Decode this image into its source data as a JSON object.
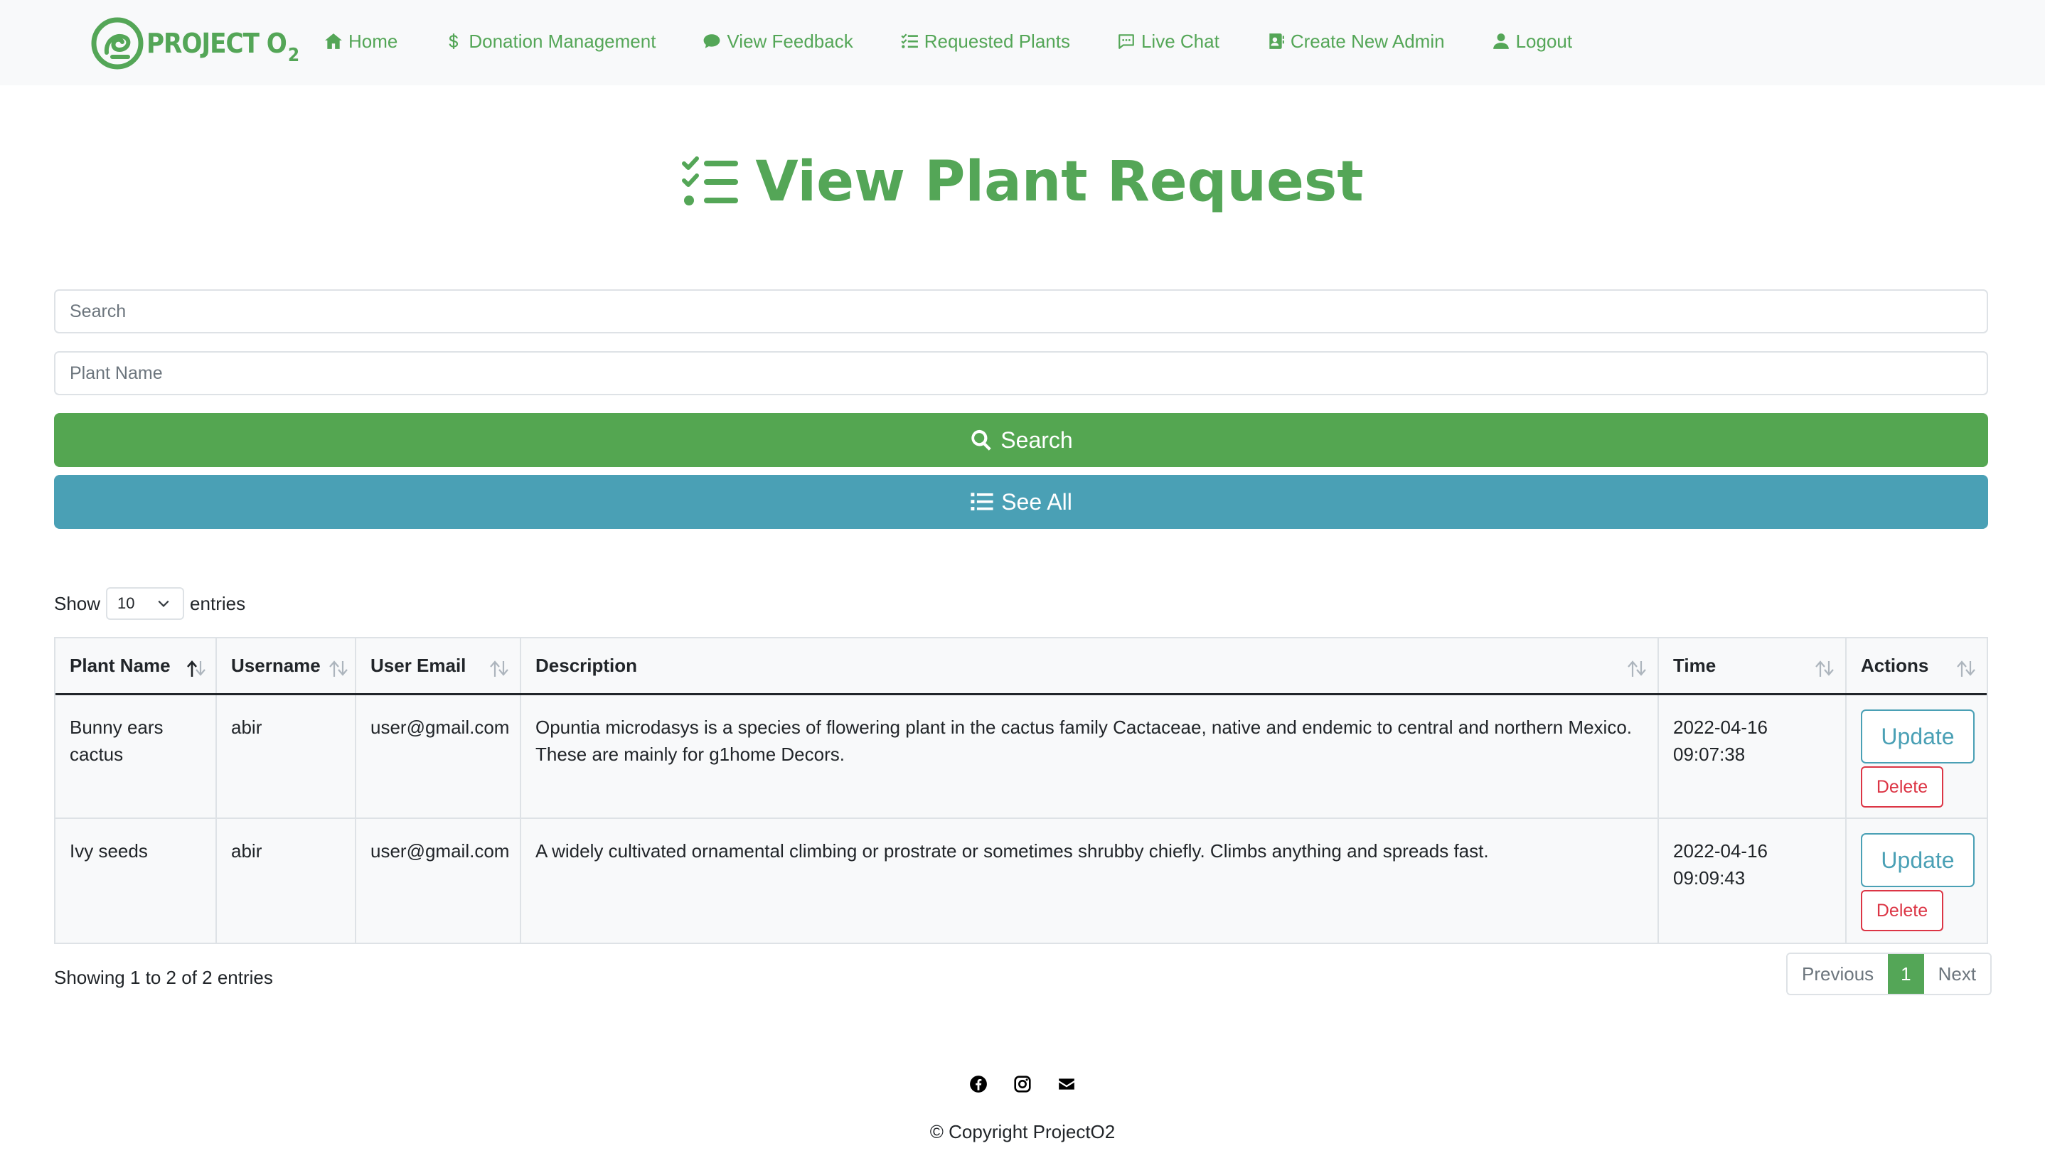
{
  "brand": {
    "name": "PROJECT O",
    "subscript": "2"
  },
  "nav": [
    {
      "label": "Home",
      "icon": "house-icon"
    },
    {
      "label": "Donation Management",
      "icon": "dollar-icon"
    },
    {
      "label": "View Feedback",
      "icon": "comment-icon"
    },
    {
      "label": "Requested Plants",
      "icon": "list-check-icon"
    },
    {
      "label": "Live Chat",
      "icon": "chat-icon"
    },
    {
      "label": "Create New Admin",
      "icon": "address-book-icon"
    },
    {
      "label": "Logout",
      "icon": "user-icon"
    }
  ],
  "page": {
    "title": "View Plant Request"
  },
  "form": {
    "search_placeholder": "Search",
    "plant_name_placeholder": "Plant Name",
    "search_button": "Search",
    "see_all_button": "See All"
  },
  "table_controls": {
    "show": "Show",
    "length_value": "10",
    "entries": "entries"
  },
  "table": {
    "columns": [
      "Plant Name",
      "Username",
      "User Email",
      "Description",
      "Time",
      "Actions"
    ],
    "rows": [
      {
        "plant_name": "Bunny ears cactus",
        "username": "abir",
        "email": "user@gmail.com",
        "description": "Opuntia microdasys is a species of flowering plant in the cactus family Cactaceae, native and endemic to central and northern Mexico. These are mainly for g1home Decors.",
        "time": "2022-04-16 09:07:38",
        "update": "Update",
        "delete": "Delete"
      },
      {
        "plant_name": "Ivy seeds",
        "username": "abir",
        "email": "user@gmail.com",
        "description": "A widely cultivated ornamental climbing or prostrate or sometimes shrubby chiefly. Climbs anything and spreads fast.",
        "time": "2022-04-16 09:09:43",
        "update": "Update",
        "delete": "Delete"
      }
    ]
  },
  "info": "Showing 1 to 2 of 2 entries",
  "pagination": {
    "previous": "Previous",
    "current": "1",
    "next": "Next"
  },
  "footer": {
    "social_icons": [
      "facebook-icon",
      "instagram-icon",
      "envelope-icon"
    ],
    "copyright": "© Copyright ProjectO2"
  },
  "colors": {
    "brand_green": "#54a657",
    "info_teal": "#4aa0b5",
    "danger": "#dc3545",
    "navbar_bg": "#f8f9fa"
  }
}
